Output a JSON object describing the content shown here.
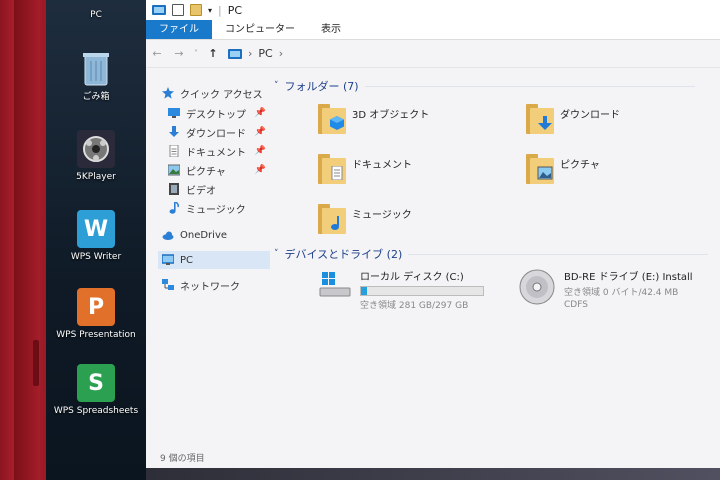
{
  "desktop": {
    "icons": [
      {
        "label": "PC",
        "icon": "pc-icon",
        "color": "#3a8fd8"
      },
      {
        "label": "ごみ箱",
        "icon": "recycle-bin-icon",
        "color": "#6aa0c8"
      },
      {
        "label": "5KPlayer",
        "icon": "5kplayer-icon",
        "color": "#2a2a3a"
      },
      {
        "label": "WPS Writer",
        "icon": "wps-writer-icon",
        "color": "#2d9fd6",
        "glyph": "W"
      },
      {
        "label": "WPS Presentation",
        "icon": "wps-presentation-icon",
        "color": "#e0702a",
        "glyph": "P"
      },
      {
        "label": "WPS Spreadsheets",
        "icon": "wps-spreadsheets-icon",
        "color": "#2aa050",
        "glyph": "S"
      }
    ]
  },
  "window": {
    "title": "PC",
    "ribbon_tabs": [
      "ファイル",
      "コンピューター",
      "表示"
    ],
    "address": {
      "location": "PC"
    },
    "nav_pane": {
      "quick_access": "クイック アクセス",
      "quick_items": [
        "デスクトップ",
        "ダウンロード",
        "ドキュメント",
        "ピクチャ",
        "ビデオ",
        "ミュージック"
      ],
      "onedrive": "OneDrive",
      "pc": "PC",
      "network": "ネットワーク"
    },
    "folders_header": "フォルダー (7)",
    "folders": [
      "3D オブジェクト",
      "ダウンロード",
      "ドキュメント",
      "ピクチャ",
      "ミュージック"
    ],
    "devices_header": "デバイスとドライブ (2)",
    "drives": [
      {
        "name": "ローカル ディスク (C:)",
        "info": "空き領域 281 GB/297 GB",
        "used_fraction": 0.05
      },
      {
        "name": "BD-RE ドライブ (E:) Install",
        "info": "空き領域 0 バイト/42.4 MB",
        "fs": "CDFS"
      }
    ],
    "status": "9 個の項目"
  }
}
